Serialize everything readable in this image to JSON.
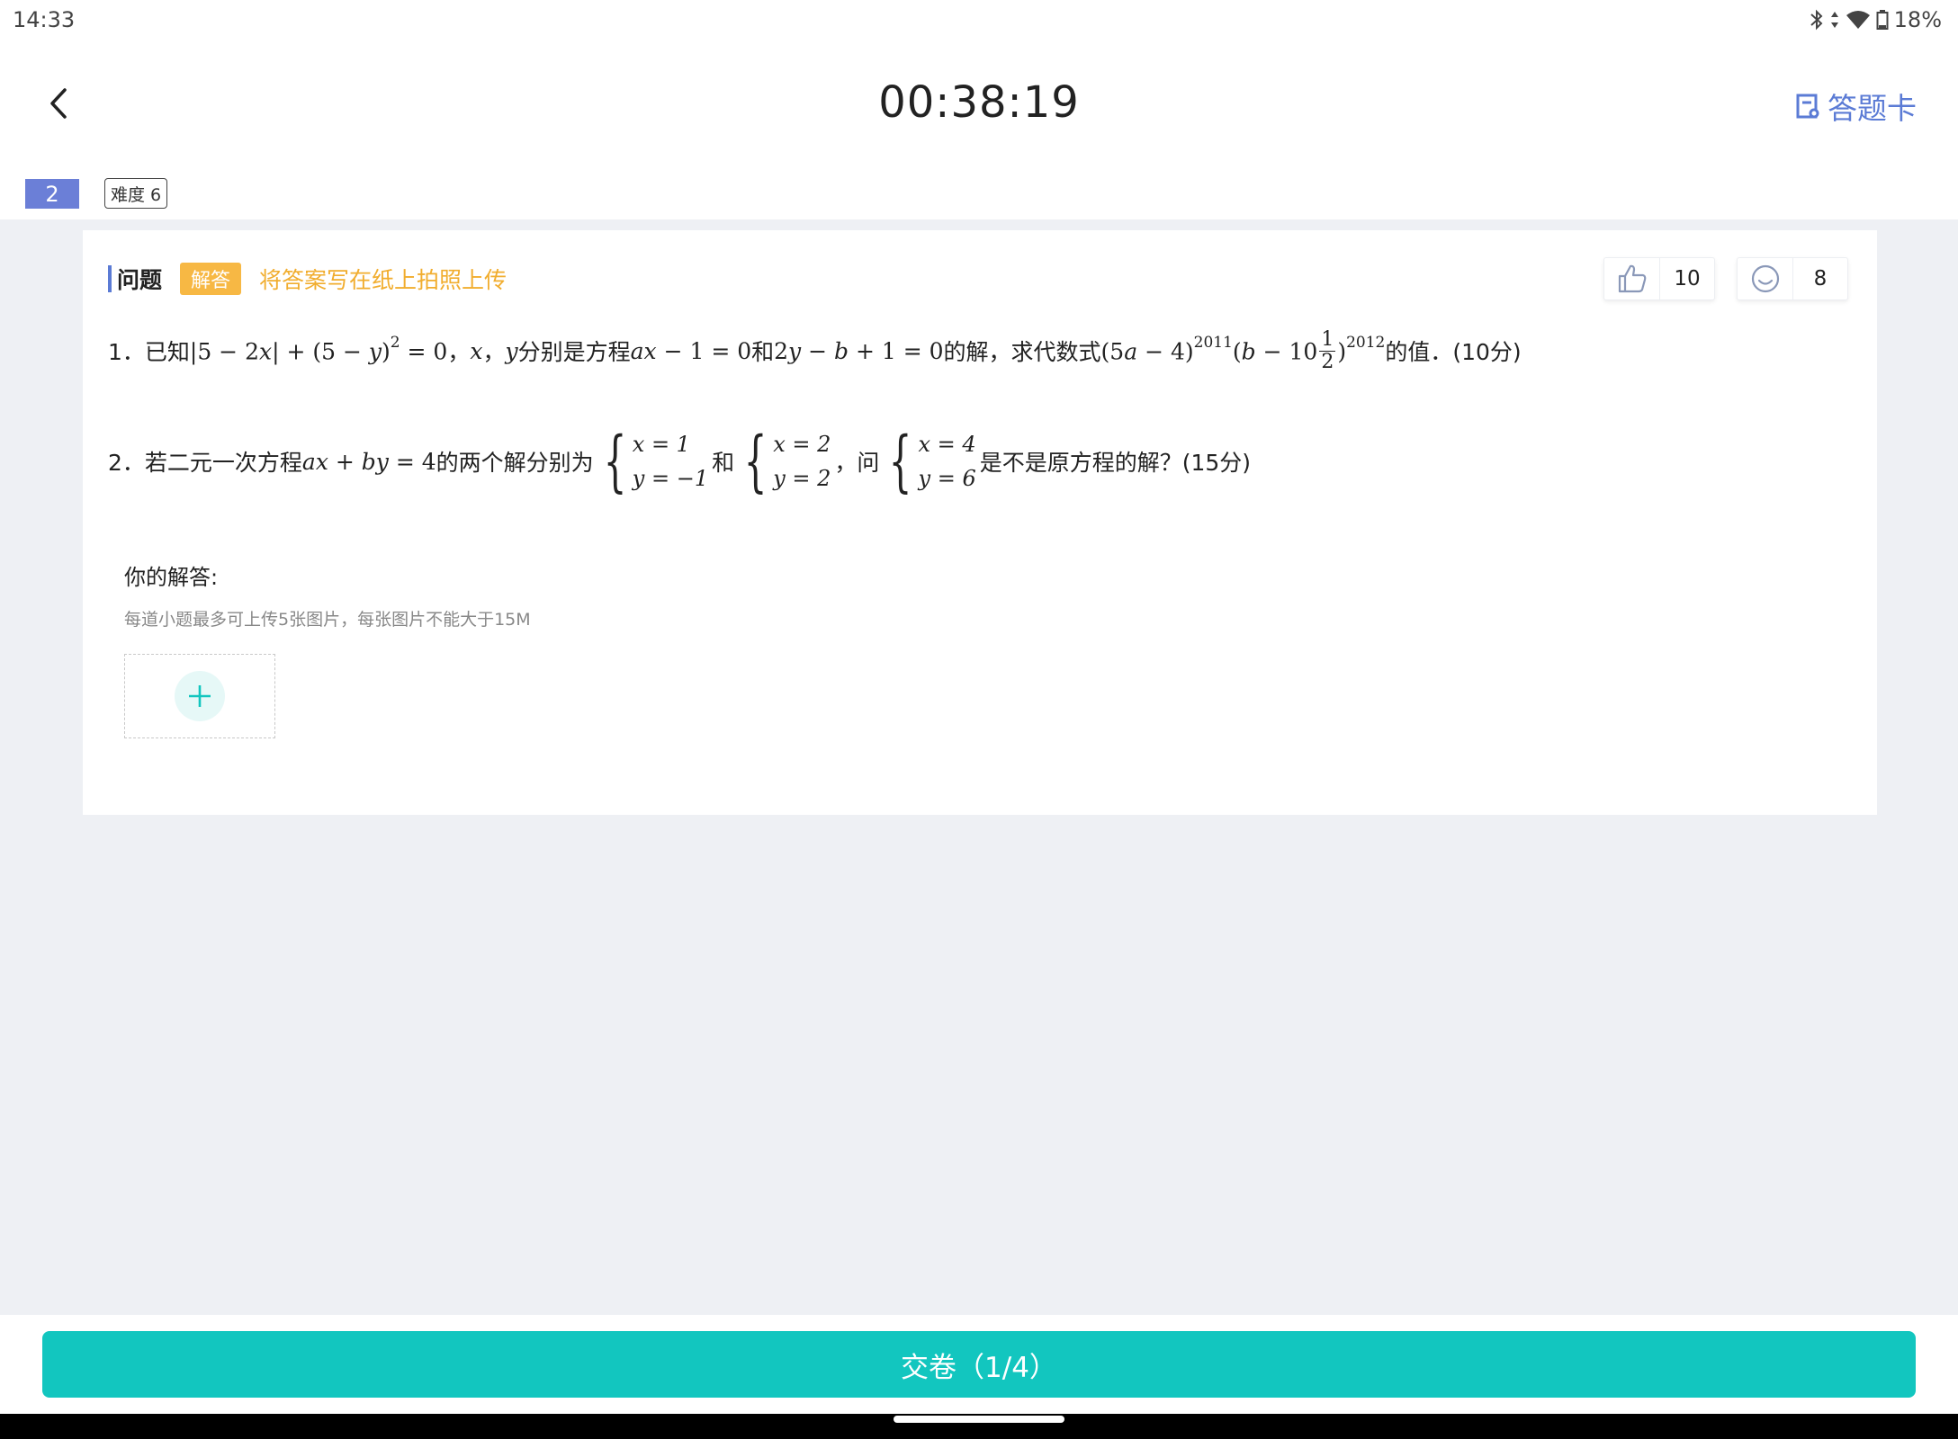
{
  "status_bar": {
    "time": "14:33",
    "battery": "18%"
  },
  "header": {
    "timer": "00:38:19",
    "answer_card_label": "答题卡"
  },
  "question_meta": {
    "number": "2",
    "difficulty": "难度 6"
  },
  "card": {
    "label": "问题",
    "type_tag": "解答",
    "hint": "将答案写在纸上拍照上传",
    "like_count": "10",
    "smile_count": "8"
  },
  "q1": {
    "prefix": "1．已知",
    "t1": "，",
    "t2": "，",
    "t3": "分别是方程",
    "t4": "和",
    "t5": "的解，求代数式",
    "t6": "的值．(10分)",
    "exp_a": "2011",
    "exp_b": "2012",
    "frac_num": "1",
    "frac_den": "2"
  },
  "q2": {
    "prefix": "2．若二元一次方程",
    "t1": "的两个解分别为",
    "t2": "和",
    "t3": "，问",
    "t4": "是不是原方程的解？(15分)",
    "sys1": [
      "x = 1",
      "y = −1"
    ],
    "sys2": [
      "x = 2",
      "y = 2"
    ],
    "sys3": [
      "x = 4",
      "y = 6"
    ]
  },
  "answer": {
    "title": "你的解答:",
    "upload_hint": "每道小题最多可上传5张图片，每张图片不能大于15M"
  },
  "footer": {
    "submit_label": "交卷（1/4）"
  },
  "colors": {
    "accent": "#5b7bd5",
    "teal": "#12c6bf",
    "tag_orange": "#f7b844",
    "badge_blue": "#6b7fd7"
  },
  "icons": [
    "back-chevron-icon",
    "answer-card-icon",
    "thumbs-up-icon",
    "smile-icon",
    "plus-icon",
    "bluetooth-icon",
    "wifi-icon",
    "battery-icon"
  ]
}
